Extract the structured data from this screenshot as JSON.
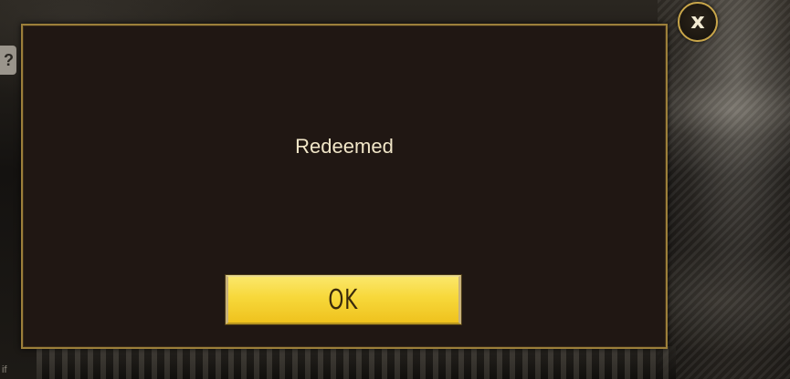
{
  "dialog": {
    "message": "Redeemed",
    "ok_label": "OK",
    "close_icon": "close-icon",
    "close_glyph": "x"
  },
  "background": {
    "help_glyph": "?",
    "edge_text": "if"
  },
  "colors": {
    "dialog_bg": "#201713",
    "dialog_border": "#9c7f3a",
    "ok_button": "#f7d83a",
    "message_text": "#f1e6c8"
  }
}
